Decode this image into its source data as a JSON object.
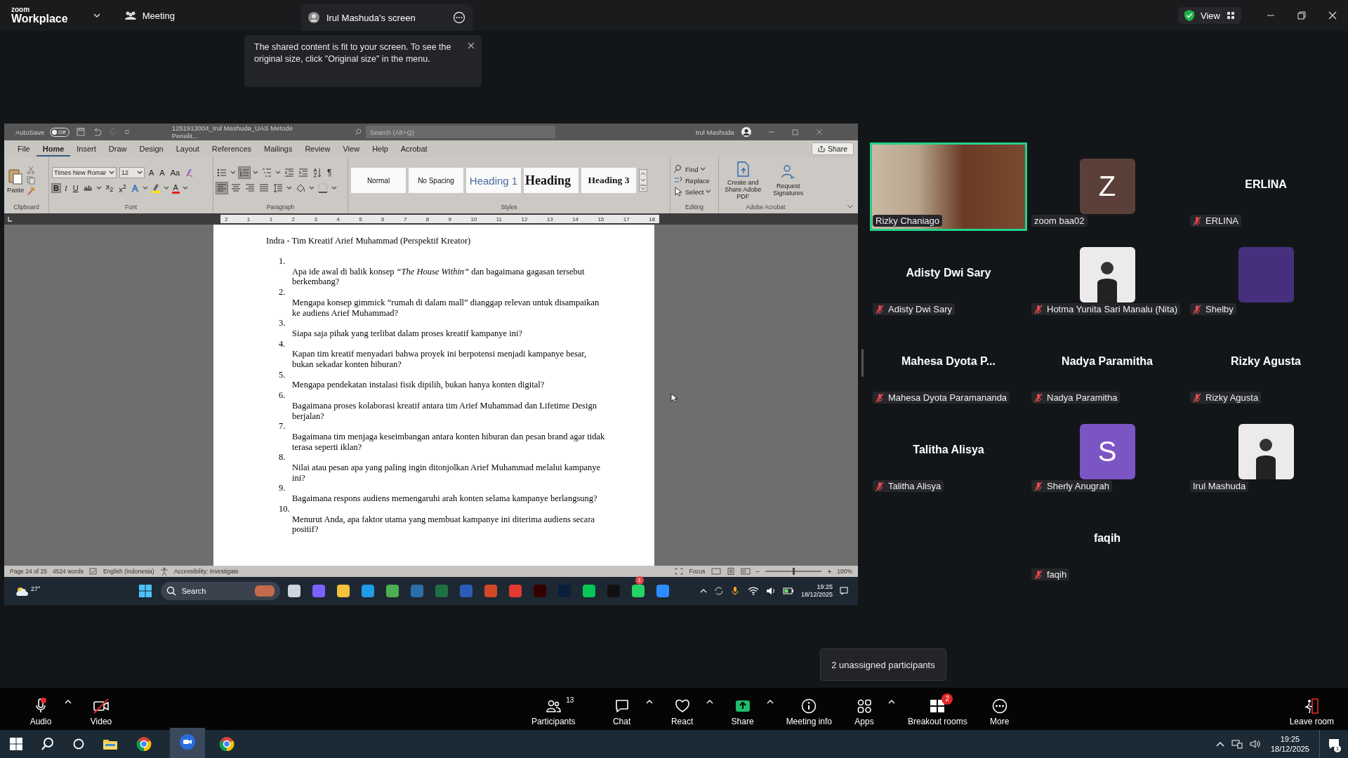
{
  "top_bar": {
    "logo_top": "zoom",
    "logo_bottom": "Workplace",
    "meeting": "Meeting",
    "share_tab": "Irul Mashuda's screen",
    "view": "View"
  },
  "notice": {
    "text": "The shared content is fit to your screen. To see the original size, click \"Original size\" in the menu."
  },
  "word": {
    "title_bar": {
      "autosave": "AutoSave",
      "autosave_on": false,
      "autosave_state": "Off",
      "document": "1251913004_Irul Mashuda_UAS Metode Penelit...",
      "search_placeholder": "Search (Alt+Q)",
      "user": "Irul Mashuda"
    },
    "tabs": [
      {
        "label": "File",
        "selected": false
      },
      {
        "label": "Home",
        "selected": true
      },
      {
        "label": "Insert",
        "selected": false
      },
      {
        "label": "Draw",
        "selected": false
      },
      {
        "label": "Design",
        "selected": false
      },
      {
        "label": "Layout",
        "selected": false
      },
      {
        "label": "References",
        "selected": false
      },
      {
        "label": "Mailings",
        "selected": false
      },
      {
        "label": "Review",
        "selected": false
      },
      {
        "label": "View",
        "selected": false
      },
      {
        "label": "Help",
        "selected": false
      },
      {
        "label": "Acrobat",
        "selected": false
      }
    ],
    "share": "Share",
    "clipboard": {
      "paste": "Paste",
      "label": "Clipboard"
    },
    "font": {
      "name": "Times New Romar",
      "size": "12",
      "row1": [
        "A",
        "A",
        "Aa"
      ],
      "label": "Font",
      "tools": [
        {
          "kind": "bold",
          "glyph": "B",
          "selected": true
        },
        {
          "kind": "italic",
          "glyph": "I",
          "selected": false
        },
        {
          "kind": "underline",
          "glyph": "U",
          "selected": false
        },
        {
          "kind": "strike",
          "glyph": "ab",
          "selected": false
        },
        {
          "kind": "sub",
          "glyph": "x$_{2}$",
          "selected": false
        },
        {
          "kind": "sup",
          "glyph": "x$^{2}$",
          "selected": false
        },
        {
          "kind": "effects",
          "glyph": "A",
          "selected": false
        },
        {
          "kind": "highlight",
          "selected": false
        },
        {
          "kind": "color",
          "glyph": "A",
          "selected": false
        }
      ]
    },
    "paragraph": {
      "label": "Paragraph",
      "row1": [
        {
          "kind": "bullets",
          "selected": false
        },
        {
          "kind": "numbering",
          "selected": true
        },
        {
          "kind": "multilevel",
          "selected": false
        },
        {
          "kind": "outdent",
          "selected": false
        },
        {
          "kind": "indent",
          "selected": false
        },
        {
          "kind": "sort",
          "selected": false
        },
        {
          "kind": "pilcrow",
          "glyph": "¶",
          "selected": false
        }
      ],
      "row2": [
        {
          "kind": "left",
          "selected": true
        },
        {
          "kind": "center",
          "selected": false
        },
        {
          "kind": "right",
          "selected": false
        },
        {
          "kind": "justify",
          "selected": false
        },
        {
          "kind": "spacing",
          "selected": false
        },
        {
          "kind": "shading",
          "selected": false
        },
        {
          "kind": "borders",
          "selected": false
        }
      ]
    },
    "styles": {
      "label": "Styles",
      "items": [
        {
          "kind": "normal",
          "label": "Normal"
        },
        {
          "kind": "nospacing",
          "label": "No Spacing"
        },
        {
          "kind": "h1",
          "label": "Heading 1"
        },
        {
          "kind": "h2",
          "label": "Heading"
        },
        {
          "kind": "h3",
          "label": "Heading 3"
        }
      ]
    },
    "editing": {
      "label": "Editing",
      "items": [
        "Find",
        "Replace",
        "Select"
      ]
    },
    "acrobat": {
      "label": "Adobe Acrobat",
      "items": [
        "Create and Share Adobe PDF",
        "Request Signatures"
      ]
    },
    "ruler": [
      "2",
      "1",
      "1",
      "2",
      "3",
      "4",
      "5",
      "6",
      "7",
      "8",
      "9",
      "10",
      "11",
      "12",
      "13",
      "14",
      "15",
      "17",
      "18"
    ],
    "document": {
      "heading": "Indra - Tim Kreatif Arief Muhammad (Perspektif Kreator)",
      "items": [
        {
          "number": "1.",
          "text": "Apa ide awal di balik konsep *“The House Within”* dan bagaimana gagasan tersebut berkembang?"
        },
        {
          "number": "2.",
          "text": "Mengapa konsep gimmick “rumah di dalam mall” dianggap relevan untuk disampaikan ke audiens Arief Muhammad?"
        },
        {
          "number": "3.",
          "text": "Siapa saja pihak yang terlibat dalam proses kreatif kampanye ini?"
        },
        {
          "number": "4.",
          "text": "Kapan tim kreatif menyadari bahwa proyek ini berpotensi menjadi kampanye besar, bukan sekadar konten hiburan?"
        },
        {
          "number": "5.",
          "text": "Mengapa pendekatan instalasi fisik dipilih, bukan hanya konten digital?"
        },
        {
          "number": "6.",
          "text": "Bagaimana proses kolaborasi kreatif antara tim Arief Muhammad dan Lifetime Design berjalan?"
        },
        {
          "number": "7.",
          "text": "Bagaimana tim menjaga keseimbangan antara konten hiburan dan pesan brand agar tidak terasa seperti iklan?"
        },
        {
          "number": "8.",
          "text": "Nilai atau pesan apa yang paling ingin ditonjolkan Arief Muhammad melalui kampanye ini?"
        },
        {
          "number": "9.",
          "text": "Bagaimana respons audiens memengaruhi arah konten selama kampanye berlangsung?"
        },
        {
          "number": "10.",
          "text": "Menurut Anda, apa faktor utama yang membuat kampanye ini diterima audiens secara positif?"
        }
      ]
    },
    "status_bar": {
      "page": "Page 24 of 25",
      "words": "4524 words",
      "language": "English (Indonesia)",
      "accessibility": "Accessibility: Investigate",
      "focus": "Focus",
      "zoom_out": "−",
      "zoom_slider": {
        "level": 0.5
      },
      "zoom_in": "+",
      "zoom": "100%"
    }
  },
  "inner_taskbar": {
    "weather": "27°",
    "search": "Search",
    "badge": "1",
    "time": "19:25",
    "date": "18/12/2025"
  },
  "participants": [
    {
      "kind": "video",
      "name": "Rizky Chaniago",
      "muted": false,
      "speaking": true
    },
    {
      "kind": "letter",
      "letter": "Z",
      "color": "#5b4039",
      "name": "zoom baa02",
      "muted": false,
      "speaking": false
    },
    {
      "kind": "name",
      "display": "ERLINA",
      "name": "ERLINA",
      "muted": true,
      "speaking": false
    },
    {
      "kind": "name",
      "display": "Adisty Dwi Sary",
      "name": "Adisty Dwi Sary",
      "muted": true,
      "speaking": false
    },
    {
      "kind": "photo",
      "name": "Hotma Yunita Sari Manalu (Nita)",
      "muted": true,
      "speaking": false
    },
    {
      "kind": "plain",
      "color": "#46307e",
      "name": "Shelby",
      "muted": true,
      "speaking": false
    },
    {
      "kind": "name",
      "display": "Mahesa Dyota P...",
      "name": "Mahesa Dyota Paramananda",
      "muted": true,
      "speaking": false
    },
    {
      "kind": "name",
      "display": "Nadya Paramitha",
      "name": "Nadya Paramitha",
      "muted": true,
      "speaking": false
    },
    {
      "kind": "name",
      "display": "Rizky Agusta",
      "name": "Rizky Agusta",
      "muted": true,
      "speaking": false
    },
    {
      "kind": "name",
      "display": "Talitha Alisya",
      "name": "Talitha Alisya",
      "muted": true,
      "speaking": false
    },
    {
      "kind": "letter",
      "letter": "S",
      "color": "#7b55c4",
      "name": "Sherly Anugrah",
      "muted": true,
      "speaking": false
    },
    {
      "kind": "photo",
      "name": "Irul Mashuda",
      "muted": false,
      "speaking": false
    },
    {
      "kind": "name",
      "display": "faqih",
      "name": "faqih",
      "muted": true,
      "speaking": false
    }
  ],
  "tooltip": "2 unassigned participants",
  "toolbar": {
    "items": [
      {
        "kind": "audio",
        "label": "Audio",
        "caret": true
      },
      {
        "kind": "video",
        "label": "Video",
        "caret": false
      },
      {
        "kind": "participants",
        "label": "Participants",
        "count": "13",
        "caret": false
      },
      {
        "kind": "chat",
        "label": "Chat",
        "caret": true
      },
      {
        "kind": "react",
        "label": "React",
        "caret": true
      },
      {
        "kind": "share",
        "label": "Share",
        "caret": true
      },
      {
        "kind": "info",
        "label": "Meeting info",
        "caret": false
      },
      {
        "kind": "apps",
        "label": "Apps",
        "caret": true
      },
      {
        "kind": "breakout",
        "label": "Breakout rooms",
        "badge": "2",
        "caret": false
      },
      {
        "kind": "more",
        "label": "More",
        "caret": false
      }
    ],
    "leave": "Leave room"
  },
  "taskbar": {
    "time": "19:25",
    "date": "18/12/2025",
    "notifications": "1"
  }
}
